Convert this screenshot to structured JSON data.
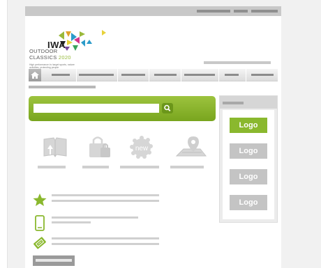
{
  "branding": {
    "name": "IWA",
    "line1": "OUTDOOR",
    "line2": "CLASSICS",
    "year": "2020",
    "tagline": "High performance in: target sports, nature activities, protecting people"
  },
  "search": {
    "placeholder": ""
  },
  "features": [
    {
      "icon": "map-book-icon"
    },
    {
      "icon": "shopping-bag-icon"
    },
    {
      "icon": "new-badge-icon",
      "badge_text": "new"
    },
    {
      "icon": "map-pin-icon"
    }
  ],
  "info_rows": [
    {
      "icon": "star-icon"
    },
    {
      "icon": "mobile-phone-icon"
    },
    {
      "icon": "ticket-icon"
    }
  ],
  "sidebar": {
    "logos": [
      {
        "label": "Logo",
        "active": true
      },
      {
        "label": "Logo",
        "active": false
      },
      {
        "label": "Logo",
        "active": false
      },
      {
        "label": "Logo",
        "active": false
      }
    ]
  },
  "colors": {
    "accent_green": "#8ab82e",
    "placeholder_gray": "#c4c4c4",
    "background": "#f1f1f1"
  }
}
